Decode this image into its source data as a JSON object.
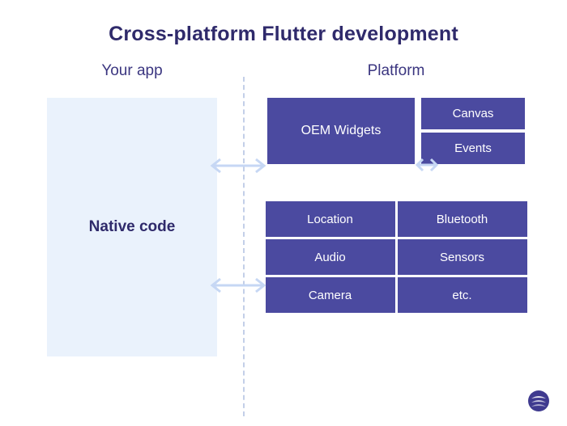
{
  "title": "Cross-platform Flutter development",
  "left": {
    "header": "Your app",
    "box": "Native code"
  },
  "right": {
    "header": "Platform",
    "oem": "OEM Widgets",
    "canvas": "Canvas",
    "events": "Events",
    "grid": {
      "r0c0": "Location",
      "r0c1": "Bluetooth",
      "r1c0": "Audio",
      "r1c1": "Sensors",
      "r2c0": "Camera",
      "r2c1": "etc."
    }
  },
  "colors": {
    "box": "#4b4aa0",
    "light": "#eaf2fc",
    "arrow": "#c6d7f4",
    "text": "#2f2a6b"
  }
}
